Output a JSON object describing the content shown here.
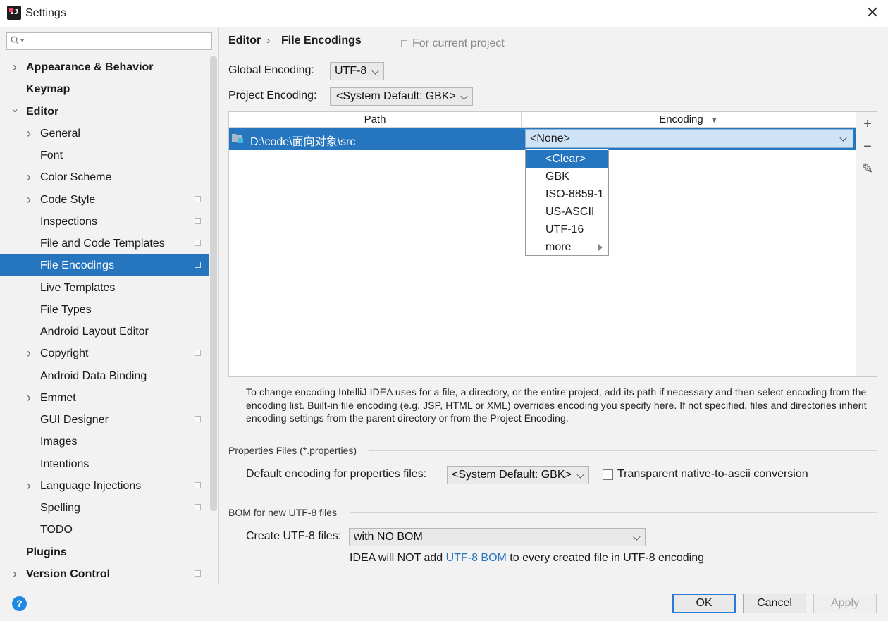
{
  "window": {
    "title": "Settings",
    "close_glyph": "✕"
  },
  "search": {
    "placeholder": ""
  },
  "sidebar": {
    "items": [
      {
        "label": "Appearance & Behavior",
        "level": 0,
        "bold": true,
        "expandable": true,
        "expanded": false
      },
      {
        "label": "Keymap",
        "level": 0,
        "bold": true
      },
      {
        "label": "Editor",
        "level": 0,
        "bold": true,
        "expandable": true,
        "expanded": true
      },
      {
        "label": "General",
        "level": 1,
        "expandable": true
      },
      {
        "label": "Font",
        "level": 1
      },
      {
        "label": "Color Scheme",
        "level": 1,
        "expandable": true
      },
      {
        "label": "Code Style",
        "level": 1,
        "expandable": true,
        "project": true
      },
      {
        "label": "Inspections",
        "level": 1,
        "project": true
      },
      {
        "label": "File and Code Templates",
        "level": 1,
        "project": true
      },
      {
        "label": "File Encodings",
        "level": 1,
        "project": true,
        "selected": true
      },
      {
        "label": "Live Templates",
        "level": 1
      },
      {
        "label": "File Types",
        "level": 1
      },
      {
        "label": "Android Layout Editor",
        "level": 1
      },
      {
        "label": "Copyright",
        "level": 1,
        "expandable": true,
        "project": true
      },
      {
        "label": "Android Data Binding",
        "level": 1
      },
      {
        "label": "Emmet",
        "level": 1,
        "expandable": true
      },
      {
        "label": "GUI Designer",
        "level": 1,
        "project": true
      },
      {
        "label": "Images",
        "level": 1
      },
      {
        "label": "Intentions",
        "level": 1
      },
      {
        "label": "Language Injections",
        "level": 1,
        "expandable": true,
        "project": true
      },
      {
        "label": "Spelling",
        "level": 1,
        "project": true
      },
      {
        "label": "TODO",
        "level": 1
      },
      {
        "label": "Plugins",
        "level": 0,
        "bold": true
      },
      {
        "label": "Version Control",
        "level": 0,
        "bold": true,
        "expandable": true,
        "project": true
      }
    ]
  },
  "header": {
    "breadcrumb_parent": "Editor",
    "breadcrumb_sep": "›",
    "breadcrumb_current": "File Encodings",
    "scope_note": "For current project"
  },
  "global_encoding": {
    "label": "Global Encoding:",
    "value": "UTF-8"
  },
  "project_encoding": {
    "label": "Project Encoding:",
    "value": "<System Default: GBK>"
  },
  "table": {
    "columns": {
      "path": "Path",
      "encoding": "Encoding",
      "encoding_sort_glyph": "▼"
    },
    "rows": [
      {
        "path": "D:\\code\\面向对象\\src",
        "encoding": "<None>",
        "icon": "folder-icon"
      }
    ],
    "tools": {
      "add": "+",
      "remove": "−",
      "edit": "✎"
    }
  },
  "encoding_dropdown": {
    "options": [
      "<Clear>",
      "GBK",
      "ISO-8859-1",
      "US-ASCII",
      "UTF-16",
      "more"
    ],
    "highlighted": "<Clear>"
  },
  "help_text": "To change encoding IntelliJ IDEA uses for a file, a directory, or the entire project, add its path if necessary and then select encoding from the encoding list. Built-in file encoding (e.g. JSP, HTML or XML) overrides encoding you specify here. If not specified, files and directories inherit encoding settings from the parent directory or from the Project Encoding.",
  "properties": {
    "section_title": "Properties Files (*.properties)",
    "default_label": "Default encoding for properties files:",
    "default_value": "<System Default: GBK>",
    "native_to_ascii_label": "Transparent native-to-ascii conversion",
    "native_to_ascii_checked": false
  },
  "bom": {
    "section_title": "BOM for new UTF-8 files",
    "create_label": "Create UTF-8 files:",
    "create_value": "with NO BOM",
    "note_prefix": "IDEA will NOT add ",
    "note_link": "UTF-8 BOM",
    "note_suffix": " to every created file in UTF-8 encoding"
  },
  "footer": {
    "help_glyph": "?",
    "ok": "OK",
    "cancel": "Cancel",
    "apply": "Apply"
  },
  "colors": {
    "accent": "#2675bf",
    "link": "#2675bf",
    "panel": "#f2f2f2"
  }
}
